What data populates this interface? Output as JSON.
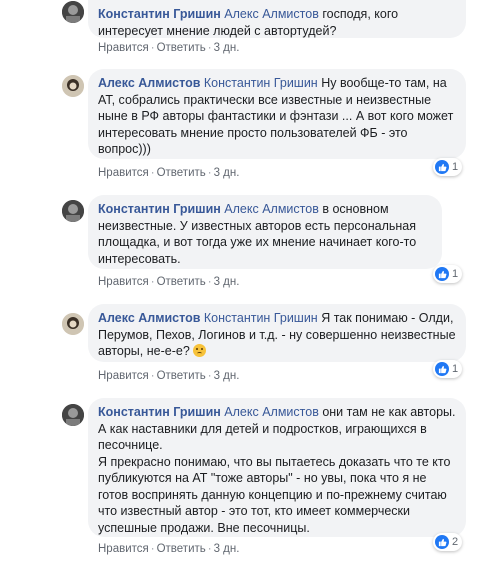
{
  "comments": [
    {
      "author": "Константин Гришин",
      "mention": "Алекс Алмистов",
      "text": " господя, кого интересует мнение людей с автортудей?",
      "actions": {
        "like": "Нравится",
        "reply": "Ответить",
        "time": "3 дн."
      },
      "reactions": null
    },
    {
      "author": "Алекс Алмистов",
      "mention": "Константин Гришин",
      "text": " Ну вообще-то там, на АТ, собрались практически все известные и неизвестные ныне в РФ авторы фантастики и фэнтази ... А вот кого может интересовать мнение просто пользователей ФБ - это вопрос)))",
      "actions": {
        "like": "Нравится",
        "reply": "Ответить",
        "time": "3 дн."
      },
      "reactions": "1"
    },
    {
      "author": "Константин Гришин",
      "mention": "Алекс Алмистов",
      "text": " в основном неизвестные. У известных авторов есть персональная площадка, и вот тогда уже их мнение начинает кого-то интересовать.",
      "actions": {
        "like": "Нравится",
        "reply": "Ответить",
        "time": "3 дн."
      },
      "reactions": "1"
    },
    {
      "author": "Алекс Алмистов",
      "mention": "Константин Гришин",
      "text": " Я так понимаю - Олди, Перумов, Пехов, Логинов и т.д. - ну совершенно неизвестные авторы, не-е-е?",
      "actions": {
        "like": "Нравится",
        "reply": "Ответить",
        "time": "3 дн."
      },
      "reactions": "1"
    },
    {
      "author": "Константин Гришин",
      "mention": "Алекс Алмистов",
      "text": " они там не как авторы. А как наставники для детей и подростков, играющихся в песочнице.",
      "text2": "Я прекрасно понимаю, что вы пытаетесь доказать что те кто публикуются на АТ \"тоже авторы\" - но увы, пока что я не готов воспринять данную концепцию и по-прежнему считаю что известный автор - это тот, кто имеет коммерчески успешные продажи. Вне песочницы.",
      "actions": {
        "like": "Нравится",
        "reply": "Ответить",
        "time": "3 дн."
      },
      "reactions": "2"
    }
  ],
  "colors": {
    "link": "#385898",
    "bubble": "#f2f3f5",
    "like": "#2078f4"
  },
  "icons": {
    "like": "thumbs-up-icon",
    "emoji": "sad-face-emoji-icon"
  }
}
